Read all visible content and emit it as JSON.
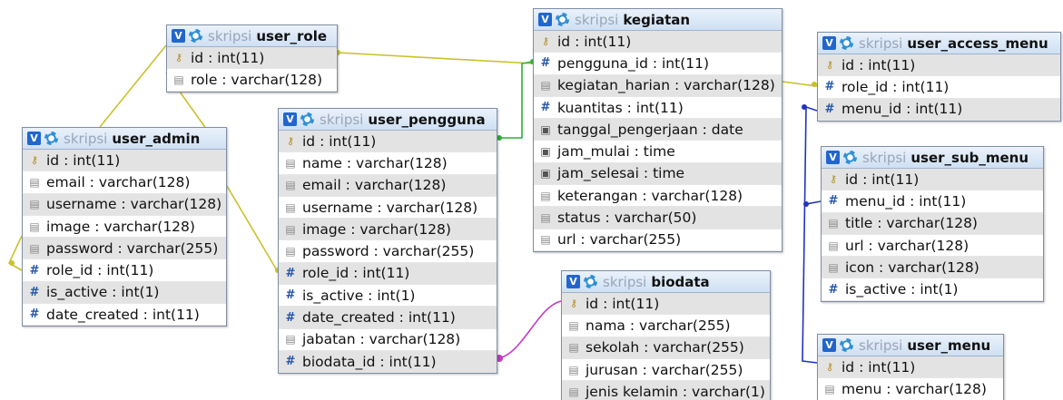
{
  "tables": [
    {
      "id": "user_role",
      "db": "skripsi",
      "name": "user_role",
      "columns": [
        {
          "type": "key",
          "text": "id : int(11)"
        },
        {
          "type": "str",
          "text": "role : varchar(128)"
        }
      ]
    },
    {
      "id": "user_admin",
      "db": "skripsi",
      "name": "user_admin",
      "columns": [
        {
          "type": "key",
          "text": "id : int(11)"
        },
        {
          "type": "str",
          "text": "email : varchar(128)"
        },
        {
          "type": "str",
          "text": "username : varchar(128)"
        },
        {
          "type": "str",
          "text": "image : varchar(128)"
        },
        {
          "type": "str",
          "text": "password : varchar(255)"
        },
        {
          "type": "num",
          "text": "role_id : int(11)"
        },
        {
          "type": "num",
          "text": "is_active : int(1)"
        },
        {
          "type": "num",
          "text": "date_created : int(11)"
        }
      ]
    },
    {
      "id": "user_pengguna",
      "db": "skripsi",
      "name": "user_pengguna",
      "columns": [
        {
          "type": "key",
          "text": "id : int(11)"
        },
        {
          "type": "str",
          "text": "name : varchar(128)"
        },
        {
          "type": "str",
          "text": "email : varchar(128)"
        },
        {
          "type": "str",
          "text": "username : varchar(128)"
        },
        {
          "type": "str",
          "text": "image : varchar(128)"
        },
        {
          "type": "str",
          "text": "password : varchar(255)"
        },
        {
          "type": "num",
          "text": "role_id : int(11)"
        },
        {
          "type": "num",
          "text": "is_active : int(1)"
        },
        {
          "type": "num",
          "text": "date_created : int(11)"
        },
        {
          "type": "str",
          "text": "jabatan : varchar(128)"
        },
        {
          "type": "num",
          "text": "biodata_id : int(11)"
        }
      ]
    },
    {
      "id": "kegiatan",
      "db": "skripsi",
      "name": "kegiatan",
      "columns": [
        {
          "type": "key",
          "text": "id : int(11)"
        },
        {
          "type": "num",
          "text": "pengguna_id : int(11)"
        },
        {
          "type": "str",
          "text": "kegiatan_harian : varchar(128)"
        },
        {
          "type": "num",
          "text": "kuantitas : int(11)"
        },
        {
          "type": "date",
          "text": "tanggal_pengerjaan : date"
        },
        {
          "type": "date",
          "text": "jam_mulai : time"
        },
        {
          "type": "date",
          "text": "jam_selesai : time"
        },
        {
          "type": "str",
          "text": "keterangan : varchar(128)"
        },
        {
          "type": "str",
          "text": "status : varchar(50)"
        },
        {
          "type": "str",
          "text": "url : varchar(255)"
        }
      ]
    },
    {
      "id": "biodata",
      "db": "skripsi",
      "name": "biodata",
      "columns": [
        {
          "type": "key",
          "text": "id : int(11)"
        },
        {
          "type": "str",
          "text": "nama : varchar(255)"
        },
        {
          "type": "str",
          "text": "sekolah : varchar(255)"
        },
        {
          "type": "str",
          "text": "jurusan : varchar(255)"
        },
        {
          "type": "str",
          "text": "jenis kelamin : varchar(1)"
        }
      ]
    },
    {
      "id": "user_access_menu",
      "db": "skripsi",
      "name": "user_access_menu",
      "columns": [
        {
          "type": "key",
          "text": "id : int(11)"
        },
        {
          "type": "num",
          "text": "role_id : int(11)"
        },
        {
          "type": "num",
          "text": "menu_id : int(11)"
        }
      ]
    },
    {
      "id": "user_sub_menu",
      "db": "skripsi",
      "name": "user_sub_menu",
      "columns": [
        {
          "type": "key",
          "text": "id : int(11)"
        },
        {
          "type": "num",
          "text": "menu_id : int(11)"
        },
        {
          "type": "str",
          "text": "title : varchar(128)"
        },
        {
          "type": "str",
          "text": "url : varchar(128)"
        },
        {
          "type": "str",
          "text": "icon : varchar(128)"
        },
        {
          "type": "num",
          "text": "is_active : int(1)"
        }
      ]
    },
    {
      "id": "user_menu",
      "db": "skripsi",
      "name": "user_menu",
      "columns": [
        {
          "type": "key",
          "text": "id : int(11)"
        },
        {
          "type": "str",
          "text": "menu : varchar(128)"
        }
      ]
    }
  ],
  "colors": {
    "relation_yellow": "#c9c12a",
    "relation_green": "#2eae3a",
    "relation_magenta": "#c43cc4",
    "relation_blue": "#2233bb",
    "header_top": "#eaf2fb",
    "header_bottom": "#cfe0f3"
  },
  "icons": {
    "header_toggle": "v-toggle-icon",
    "header_settings": "gear-icon",
    "key": "primary-key-icon",
    "num": "hash-icon",
    "str": "string-icon",
    "date": "date-icon"
  }
}
